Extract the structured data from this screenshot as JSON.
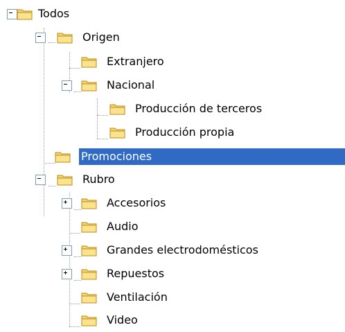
{
  "colors": {
    "selection_background": "#316ac5",
    "selection_text": "#ffffff",
    "folder_fill": "#f5d66e",
    "folder_stroke": "#b98b1e",
    "tree_lines": "#9a9a9a"
  },
  "tree": {
    "nodes": [
      {
        "id": "todos",
        "label": "Todos",
        "icon": "folder-icon",
        "toggle": "minus",
        "selected": false
      },
      {
        "id": "origen",
        "label": "Origen",
        "icon": "folder-icon",
        "toggle": "minus",
        "selected": false
      },
      {
        "id": "extranjero",
        "label": "Extranjero",
        "icon": "folder-icon",
        "toggle": "none",
        "selected": false
      },
      {
        "id": "nacional",
        "label": "Nacional",
        "icon": "folder-icon",
        "toggle": "minus",
        "selected": false
      },
      {
        "id": "produccion-terceros",
        "label": "Producción de terceros",
        "icon": "folder-icon",
        "toggle": "none",
        "selected": false
      },
      {
        "id": "produccion-propia",
        "label": "Producción propia",
        "icon": "folder-icon",
        "toggle": "none",
        "selected": false
      },
      {
        "id": "promociones",
        "label": "Promociones",
        "icon": "folder-icon",
        "toggle": "none",
        "selected": true
      },
      {
        "id": "rubro",
        "label": "Rubro",
        "icon": "folder-icon",
        "toggle": "minus",
        "selected": false
      },
      {
        "id": "accesorios",
        "label": "Accesorios",
        "icon": "folder-icon",
        "toggle": "plus",
        "selected": false
      },
      {
        "id": "audio",
        "label": "Audio",
        "icon": "folder-icon",
        "toggle": "none",
        "selected": false
      },
      {
        "id": "grandes-electrodomesticos",
        "label": "Grandes electrodomésticos",
        "icon": "folder-icon",
        "toggle": "plus",
        "selected": false
      },
      {
        "id": "repuestos",
        "label": "Repuestos",
        "icon": "folder-icon",
        "toggle": "plus",
        "selected": false
      },
      {
        "id": "ventilacion",
        "label": "Ventilación",
        "icon": "folder-icon",
        "toggle": "none",
        "selected": false
      },
      {
        "id": "video",
        "label": "Video",
        "icon": "folder-icon",
        "toggle": "none",
        "selected": false
      }
    ]
  }
}
